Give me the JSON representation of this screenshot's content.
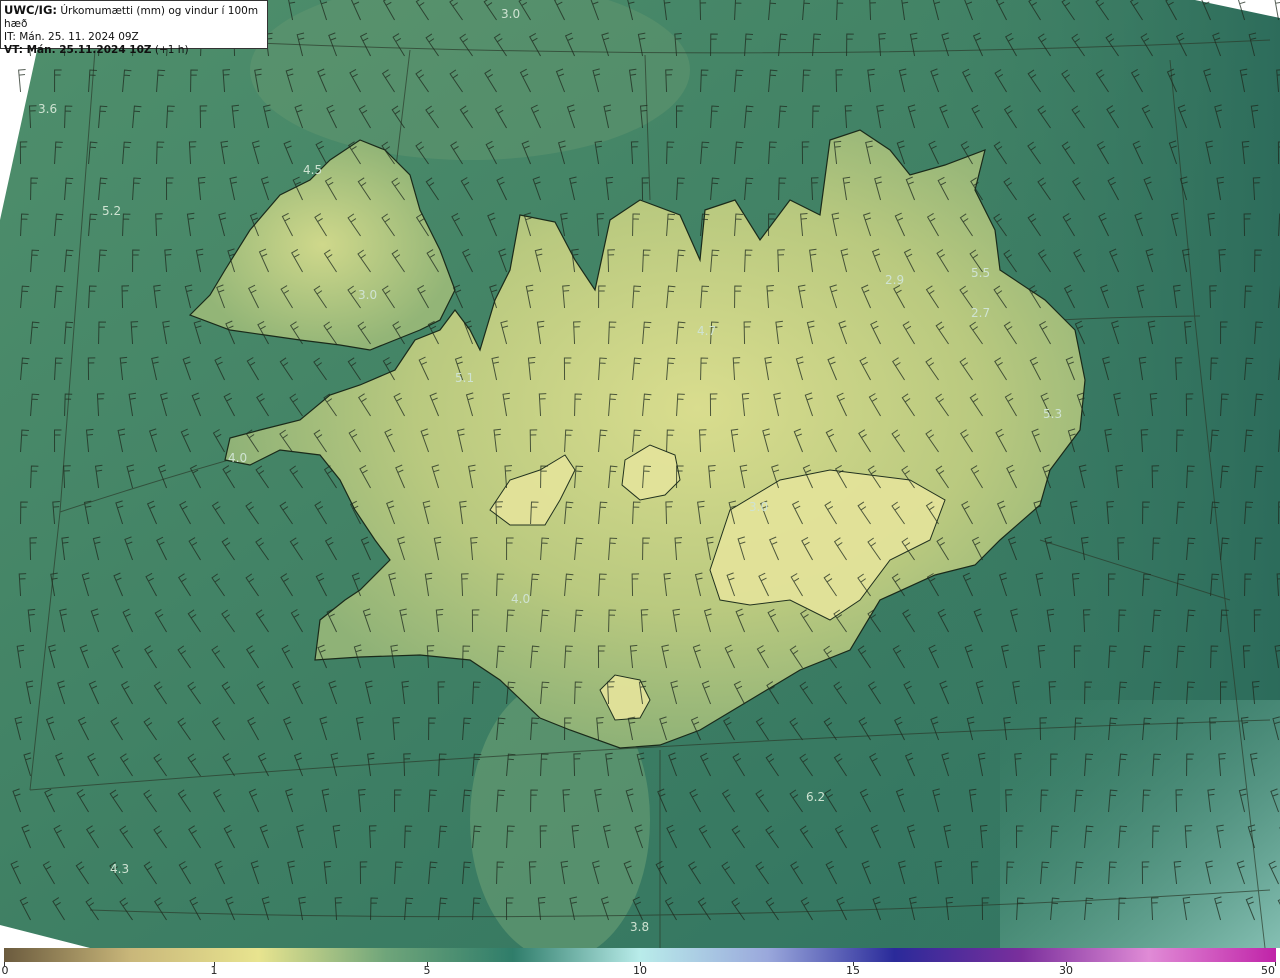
{
  "info": {
    "code": "UWC/IG:",
    "title": "Úrkomumætti (mm) og vindur í 100m hæð",
    "it_line": "IT: Mán. 25. 11. 2024 09Z",
    "vt_bold": "VT: Mán. 25.11.2024 10Z",
    "vt_offset": "(+1 h)"
  },
  "value_labels": [
    "3.0",
    "3.6",
    "4.5",
    "5.2",
    "3.0",
    "2.9",
    "5.5",
    "2.7",
    "4.7",
    "5.1",
    "5.3",
    "4.0",
    "3.0",
    "4.0",
    "6.2",
    "4.3",
    "3.8"
  ],
  "colorbar": {
    "ticks": [
      "0",
      "1",
      "5",
      "10",
      "15",
      "30",
      "50"
    ],
    "stops": [
      "#6b5b3e",
      "#c9b77a",
      "#e8e48f",
      "#6fa57a",
      "#2f7d6a",
      "#b9ecea",
      "#9aa8dc",
      "#2a2a9a",
      "#7a2f9c",
      "#e08bd6",
      "#c023a8"
    ]
  },
  "colors": {
    "sea_dark": "#2f6d5c",
    "sea_mid": "#4e8c6a",
    "land_light": "#d8dc8c",
    "coast": "#1a2a1a"
  }
}
